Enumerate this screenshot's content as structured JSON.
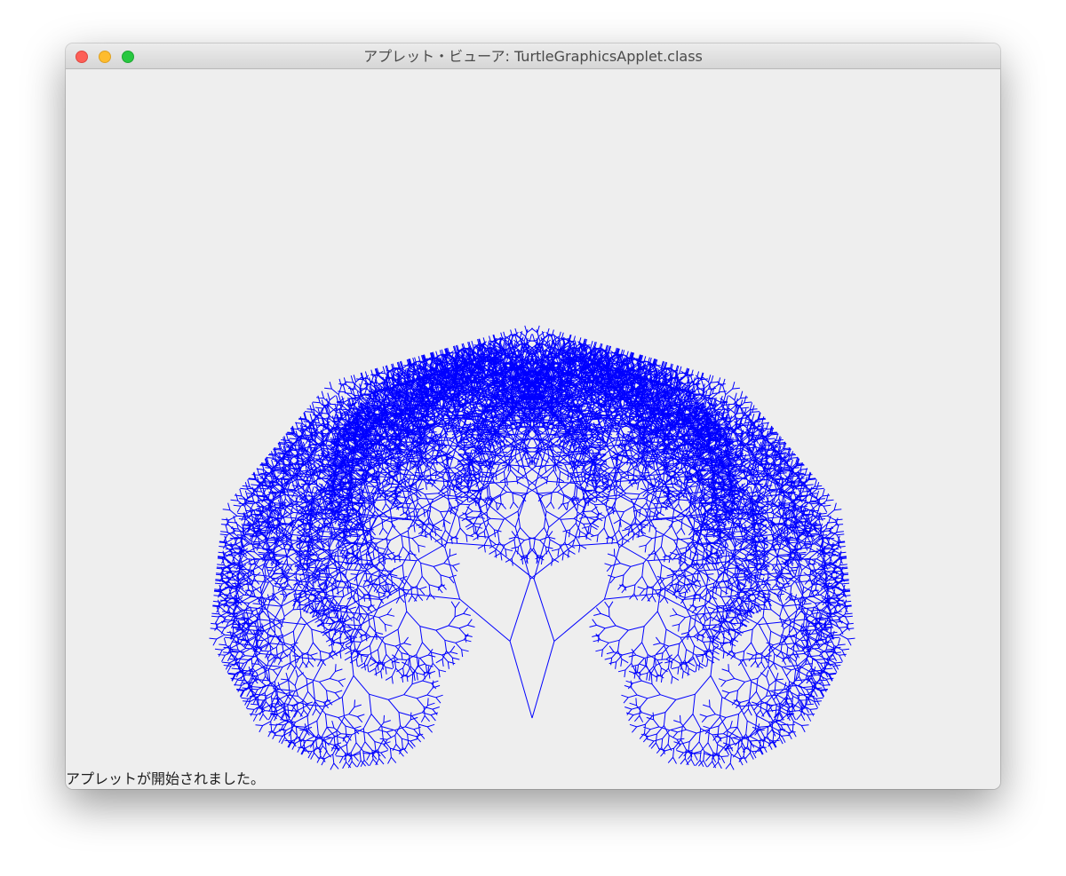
{
  "window": {
    "title": "アプレット・ビューア: TurtleGraphicsApplet.class",
    "status_text": "アプレットが開始されました。"
  },
  "window_controls": {
    "close_icon": "close-icon",
    "minimize_icon": "minimize-icon",
    "zoom_icon": "zoom-icon",
    "close_color": "#fd5f57",
    "minimize_color": "#febc2e",
    "zoom_color": "#28c840"
  },
  "drawing": {
    "subject": "recursive branching tree",
    "line_color": "#0000ff",
    "background_color": "#eeeeee"
  }
}
